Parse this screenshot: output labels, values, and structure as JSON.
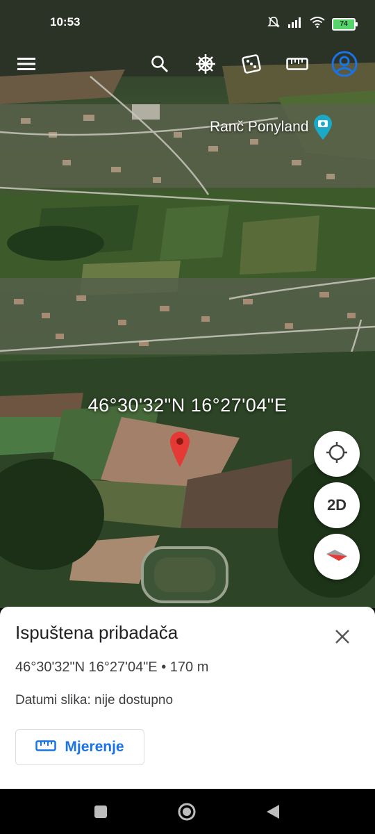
{
  "status_bar": {
    "time": "10:53",
    "battery": "74",
    "icons": [
      "mute-icon",
      "signal-icon",
      "wifi-icon",
      "battery-icon"
    ]
  },
  "toolbar": {
    "icons": [
      "menu-icon",
      "search-icon",
      "voyager-icon",
      "feeling-lucky-icon",
      "measure-icon",
      "account-icon"
    ]
  },
  "map": {
    "place_label": "Ranč Ponyland",
    "coordinates": "46°30'32\"N 16°27'04\"E",
    "pin_color": "#e53935"
  },
  "controls": {
    "locate_icon": "my-location-icon",
    "view_mode": "2D",
    "compass_icon": "compass-icon"
  },
  "sheet": {
    "title": "Ispuštena pribadača",
    "coords_line": "46°30'32\"N 16°27'04\"E • 170 m",
    "date_line": "Datumi slika: nije dostupno",
    "measure_label": "Mjerenje",
    "accent_color": "#1a73e8"
  },
  "navbar": {
    "icons": [
      "recents-icon",
      "home-icon",
      "back-icon"
    ]
  }
}
